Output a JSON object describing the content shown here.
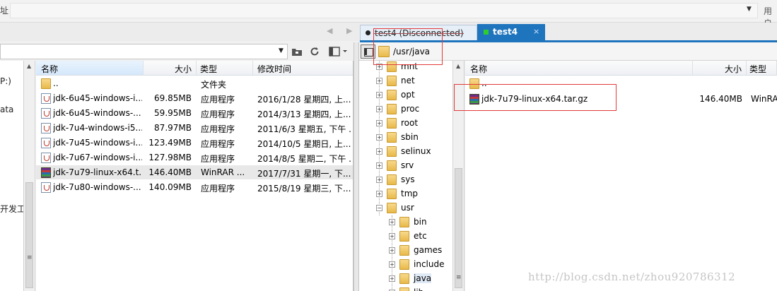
{
  "topbar": {
    "address_label": "址",
    "use_label": "用户"
  },
  "tabs": [
    {
      "label": "test4 (Disconnected)",
      "status_color": "#222222"
    },
    {
      "label": "test4",
      "status_color": "#2ecc2e",
      "close": "×"
    }
  ],
  "nav_arrows": "◀ ▶",
  "left_nav": {
    "items": [
      "P:)",
      "ata",
      "开发工"
    ]
  },
  "left_list": {
    "headers": [
      "名称",
      "大小",
      "类型",
      "修改时间"
    ],
    "rows": [
      {
        "name": "..",
        "size": "",
        "type": "文件夹",
        "mtime": "",
        "icon": "folder-icon"
      },
      {
        "name": "jdk-6u45-windows-i...",
        "size": "69.85MB",
        "type": "应用程序",
        "mtime": "2016/1/28 星期四, 上...",
        "icon": "java-icon"
      },
      {
        "name": "jdk-6u45-windows-...",
        "size": "59.95MB",
        "type": "应用程序",
        "mtime": "2014/3/13 星期四, 上...",
        "icon": "java-icon"
      },
      {
        "name": "jdk-7u4-windows-i5...",
        "size": "87.97MB",
        "type": "应用程序",
        "mtime": "2011/6/3 星期五, 下午 ...",
        "icon": "java-icon"
      },
      {
        "name": "jdk-7u45-windows-i...",
        "size": "123.49MB",
        "type": "应用程序",
        "mtime": "2014/10/5 星期日, 上...",
        "icon": "java-icon"
      },
      {
        "name": "jdk-7u67-windows-i...",
        "size": "127.98MB",
        "type": "应用程序",
        "mtime": "2014/8/5 星期二, 下午 ...",
        "icon": "java-icon"
      },
      {
        "name": "jdk-7u79-linux-x64.t...",
        "size": "146.40MB",
        "type": "WinRAR ...",
        "mtime": "2017/7/31 星期一, 下...",
        "icon": "rar-icon"
      },
      {
        "name": "jdk-7u80-windows-...",
        "size": "140.09MB",
        "type": "应用程序",
        "mtime": "2015/8/19 星期三, 下...",
        "icon": "java-icon"
      }
    ]
  },
  "right_path": "/usr/java",
  "tree": {
    "top_nodes": [
      "mnt",
      "net",
      "opt",
      "proc",
      "root",
      "sbin",
      "selinux",
      "srv",
      "sys",
      "tmp",
      "usr"
    ],
    "usr_children": [
      "bin",
      "etc",
      "games",
      "include",
      "java",
      "lib"
    ]
  },
  "right_list": {
    "headers": [
      "名称",
      "大小",
      "类型"
    ],
    "rows": [
      {
        "name": "..",
        "size": "",
        "type": "",
        "icon": "folder-icon"
      },
      {
        "name": "jdk-7u79-linux-x64.tar.gz",
        "size": "146.40MB",
        "type": "WinRA",
        "icon": "rar-icon"
      }
    ]
  },
  "watermark": "http://blog.csdn.net/zhou920786312",
  "colors": {
    "tab_active": "#1e74bd",
    "annotation_red": "#e23b3b",
    "selected_header": "#d5e8fb"
  }
}
